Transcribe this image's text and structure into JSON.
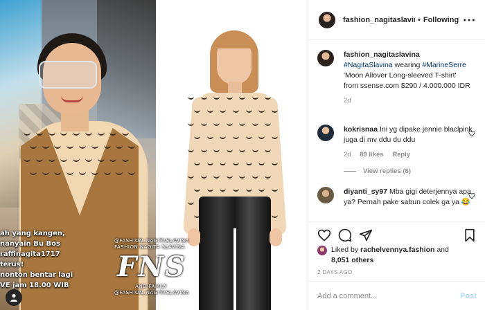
{
  "post": {
    "overlay_caption_lines": [
      "ah yang kangen,",
      "nanyain Bu Bos",
      "raffinagita1717",
      "terus!",
      "nonton bentar lagi",
      "VE jam 18.00 WIB"
    ],
    "watermark": {
      "top_text": "@FASHION_NAGITASLAVINA",
      "middle_text": "FASHION NAGITA SLAVINA",
      "logo_text": "FNS",
      "family_text": "AND FAMILY",
      "bottom_text": "@FASHION_NAGITASLAVINA"
    }
  },
  "header": {
    "username": "fashion_nagitaslavina",
    "separator": "•",
    "follow_status": "Following",
    "more_icon": "more-horizontal-icon"
  },
  "caption": {
    "username": "fashion_nagitaslavina",
    "tag1": "#NagitaSlavina",
    "wearing": " wearing ",
    "tag2": "#MarineSerre",
    "text": "'Moon Allover Long-sleeved T-shirt' from ssense.com $290 / 4.000.000 IDR",
    "age": "2d"
  },
  "comments": [
    {
      "username": "kokrisnaa",
      "text": "Ini yg dipake jennie blaclpink juga di mv ddu du ddu",
      "age": "2d",
      "likes": "89 likes",
      "reply_label": "Reply",
      "view_replies": "View replies (6)"
    },
    {
      "username": "diyanti_sy97",
      "text": "Mba gigi deterjennya apa ya? Pernah pake sabun colek ga ya 😂"
    }
  ],
  "actions": {
    "like_icon": "heart-icon",
    "comment_icon": "comment-icon",
    "share_icon": "share-icon",
    "save_icon": "bookmark-icon"
  },
  "likes": {
    "prefix": "Liked by ",
    "user": "rachelvennya.fashion",
    "and": " and",
    "others": "8,051 others"
  },
  "timestamp": "2 DAYS AGO",
  "add_comment": {
    "placeholder": "Add a comment...",
    "post_label": "Post"
  },
  "colors": {
    "text": "#262626",
    "muted": "#8e8e8e",
    "link": "#00376b",
    "post_button": "#b3dbff",
    "border": "#efefef"
  }
}
